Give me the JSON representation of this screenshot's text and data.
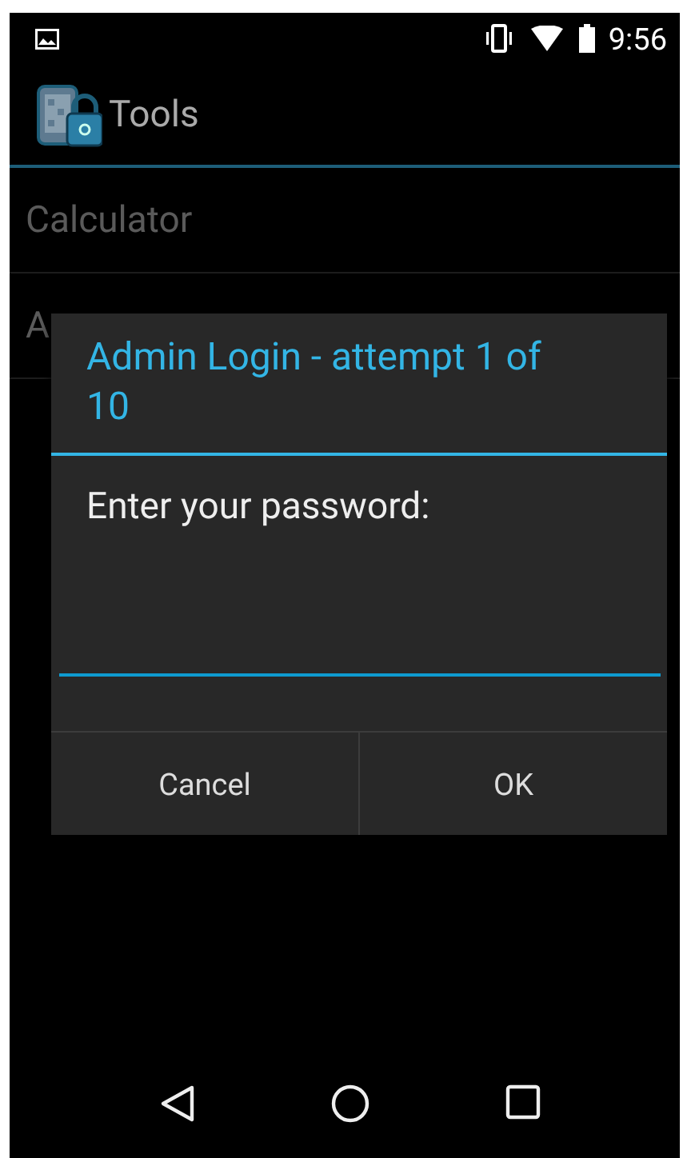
{
  "status_bar": {
    "time": "9:56"
  },
  "action_bar": {
    "title": "Tools"
  },
  "list": {
    "items": [
      {
        "label": "Calculator"
      },
      {
        "label": "A"
      }
    ]
  },
  "dialog": {
    "title": "Admin Login - attempt 1 of 10",
    "message": "Enter your password:",
    "password_field": {
      "focused": true
    },
    "buttons": [
      {
        "label": "Cancel"
      },
      {
        "label": "OK"
      }
    ]
  },
  "nav_bar": {
    "buttons": [
      {
        "kind": "back"
      },
      {
        "kind": "home"
      },
      {
        "kind": "recents"
      }
    ]
  }
}
